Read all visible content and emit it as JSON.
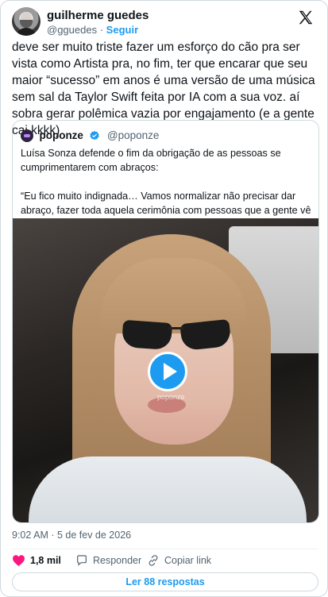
{
  "author": {
    "name": "guilherme guedes",
    "handle": "@gguedes",
    "separator": "·",
    "follow_label": "Seguir"
  },
  "tweet": {
    "text": "deve ser muito triste fazer um esforço do cão pra ser vista como Artista pra, no fim, ter que encarar que seu maior “sucesso” em anos é uma versão de uma música sem sal da Taylor Swift feita por IA com a sua voz. aí sobra gerar polêmica vazia por engajamento (e a gente cai kkkk)",
    "timestamp": "9:02 AM · 5 de fev de 2026"
  },
  "quote": {
    "name": "poponze",
    "handle": "@poponze",
    "text": "Luísa Sonza defende o fim da obrigação de as pessoas se cumprimentarem com abraços:\n\n“Eu fico muito indignada… Vamos normalizar não precisar dar abraço, fazer toda aquela cerimônia com pessoas que a gente vê todo dia.”",
    "video_watermark": "poponze"
  },
  "actions": {
    "likes": "1,8 mil",
    "reply_label": "Responder",
    "copy_label": "Copiar link",
    "read_more": "Ler 88 respostas"
  },
  "colors": {
    "accent": "#1d9bf0",
    "like": "#f91880",
    "text_secondary": "#536471"
  },
  "icons": {
    "platform": "x-logo-icon",
    "verified": "verified-badge-icon",
    "like": "heart-icon",
    "reply": "speech-bubble-icon",
    "copy": "link-icon",
    "play": "play-icon"
  }
}
